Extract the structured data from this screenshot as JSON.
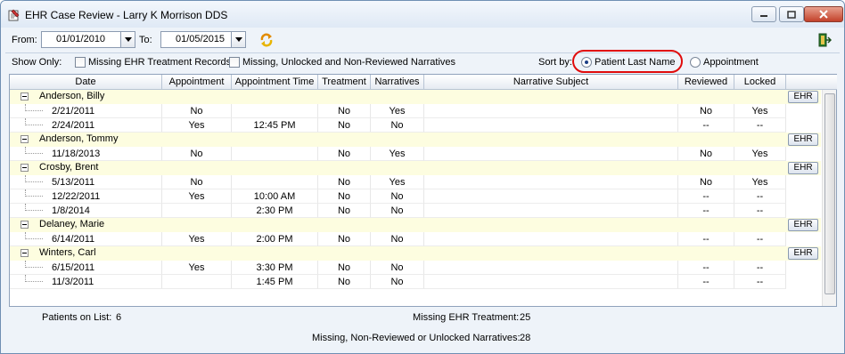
{
  "window": {
    "title": "EHR Case Review - Larry K Morrison DDS"
  },
  "toolbar": {
    "from_label": "From:",
    "from_value": "01/01/2010",
    "to_label": "To:",
    "to_value": "01/05/2015"
  },
  "filters": {
    "show_only_label": "Show Only:",
    "missing_ehr_label": "Missing EHR Treatment Records",
    "missing_narratives_label": "Missing, Unlocked and Non-Reviewed Narratives",
    "sort_by_label": "Sort by:",
    "sort_patient_label": "Patient Last Name",
    "sort_appointment_label": "Appointment",
    "selected_sort": "Patient Last Name"
  },
  "grid": {
    "columns": [
      "Date",
      "Appointment",
      "Appointment Time",
      "Treatment",
      "Narratives",
      "Narrative Subject",
      "Reviewed",
      "Locked"
    ],
    "ehr_button_label": "EHR",
    "patients": [
      {
        "name": "Anderson, Billy",
        "rows": [
          {
            "date": "2/21/2011",
            "appointment": "No",
            "time": "",
            "treatment": "No",
            "narratives": "Yes",
            "subject": "",
            "reviewed": "No",
            "locked": "Yes"
          },
          {
            "date": "2/24/2011",
            "appointment": "Yes",
            "time": "12:45 PM",
            "treatment": "No",
            "narratives": "No",
            "subject": "",
            "reviewed": "--",
            "locked": "--"
          }
        ]
      },
      {
        "name": "Anderson, Tommy",
        "rows": [
          {
            "date": "11/18/2013",
            "appointment": "No",
            "time": "",
            "treatment": "No",
            "narratives": "Yes",
            "subject": "",
            "reviewed": "No",
            "locked": "Yes"
          }
        ]
      },
      {
        "name": "Crosby, Brent",
        "rows": [
          {
            "date": "5/13/2011",
            "appointment": "No",
            "time": "",
            "treatment": "No",
            "narratives": "Yes",
            "subject": "",
            "reviewed": "No",
            "locked": "Yes"
          },
          {
            "date": "12/22/2011",
            "appointment": "Yes",
            "time": "10:00 AM",
            "treatment": "No",
            "narratives": "No",
            "subject": "",
            "reviewed": "--",
            "locked": "--"
          },
          {
            "date": "1/8/2014",
            "appointment": "",
            "time": "2:30 PM",
            "treatment": "No",
            "narratives": "No",
            "subject": "",
            "reviewed": "--",
            "locked": "--"
          }
        ]
      },
      {
        "name": "Delaney, Marie",
        "rows": [
          {
            "date": "6/14/2011",
            "appointment": "Yes",
            "time": "2:00 PM",
            "treatment": "No",
            "narratives": "No",
            "subject": "",
            "reviewed": "--",
            "locked": "--"
          }
        ]
      },
      {
        "name": "Winters, Carl",
        "rows": [
          {
            "date": "6/15/2011",
            "appointment": "Yes",
            "time": "3:30 PM",
            "treatment": "No",
            "narratives": "No",
            "subject": "",
            "reviewed": "--",
            "locked": "--"
          },
          {
            "date": "11/3/2011",
            "appointment": "",
            "time": "1:45 PM",
            "treatment": "No",
            "narratives": "No",
            "subject": "",
            "reviewed": "--",
            "locked": "--"
          }
        ]
      }
    ]
  },
  "summary": {
    "patients_label": "Patients on List:",
    "patients_value": "6",
    "missing_ehr_label": "Missing EHR Treatment:",
    "missing_ehr_value": "25",
    "missing_narr_label": "Missing, Non-Reviewed or Unlocked Narratives:",
    "missing_narr_value": "28"
  },
  "colors": {
    "accent": "#e00b0b",
    "patient_row": "#fdfde0"
  },
  "icons": [
    "window-app-icon",
    "minimize-icon",
    "maximize-icon",
    "close-icon",
    "calendar-dropdown-icon",
    "refresh-icon",
    "exit-door-icon",
    "collapse-icon"
  ]
}
